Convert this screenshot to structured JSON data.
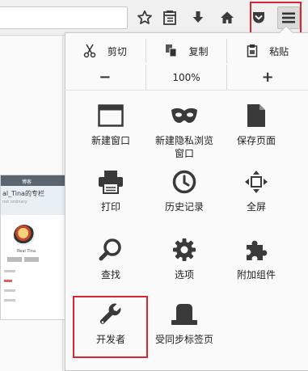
{
  "toolbar": {
    "buttons": [
      "star-icon",
      "reader-icon",
      "download-icon",
      "home-icon",
      "pocket-icon",
      "menu-icon"
    ]
  },
  "background_page": {
    "site_header": "博客",
    "blog_title": "al_Tina的专栏",
    "blog_subtitle": "not ordinary",
    "user_name": "Real Tina"
  },
  "menu": {
    "edit": {
      "cut": "剪切",
      "copy": "复制",
      "paste": "粘贴"
    },
    "zoom": {
      "minus": "−",
      "level": "100%",
      "plus": "+"
    },
    "items": [
      {
        "label": "新建窗口",
        "icon": "new-window-icon"
      },
      {
        "label": "新建隐私浏览\n窗口",
        "icon": "private-mask-icon"
      },
      {
        "label": "保存页面",
        "icon": "save-page-icon"
      },
      {
        "label": "打印",
        "icon": "print-icon"
      },
      {
        "label": "历史记录",
        "icon": "history-clock-icon"
      },
      {
        "label": "全屏",
        "icon": "fullscreen-icon"
      },
      {
        "label": "查找",
        "icon": "find-magnifier-icon"
      },
      {
        "label": "选项",
        "icon": "options-gear-icon"
      },
      {
        "label": "附加组件",
        "icon": "addons-puzzle-icon"
      },
      {
        "label": "开发者",
        "icon": "developer-wrench-icon"
      },
      {
        "label": "受同步标签页",
        "icon": "synced-tabs-icon"
      }
    ]
  },
  "highlight_color": "#d6262f"
}
